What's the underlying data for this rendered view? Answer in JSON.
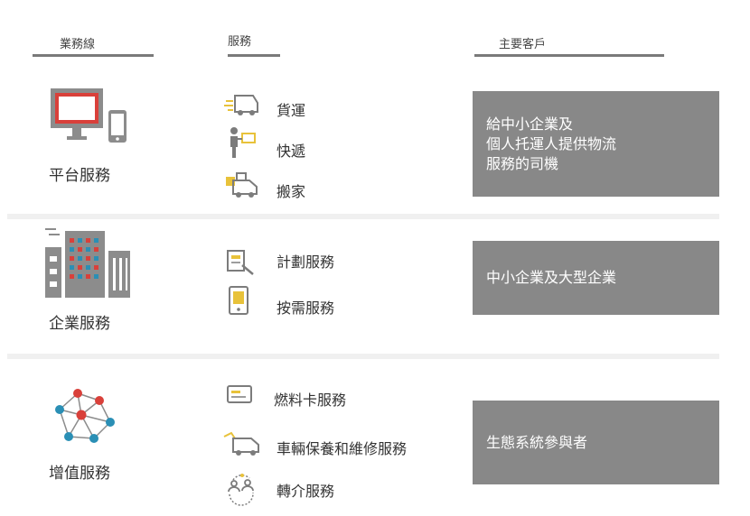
{
  "headers": {
    "business_line": "業務線",
    "service": "服務",
    "main_customer": "主要客戶"
  },
  "rows": [
    {
      "category": "平台服務",
      "category_icon": "computer-mobile-icon",
      "services": [
        {
          "label": "貨運",
          "icon": "delivery-van-icon"
        },
        {
          "label": "快遞",
          "icon": "courier-icon"
        },
        {
          "label": "搬家",
          "icon": "moving-truck-icon"
        }
      ],
      "customer_lines": [
        "給中小企業及",
        "個人托運人提供物流",
        "服務的司機"
      ]
    },
    {
      "category": "企業服務",
      "category_icon": "office-buildings-icon",
      "services": [
        {
          "label": "計劃服務",
          "icon": "plan-document-icon"
        },
        {
          "label": "按需服務",
          "icon": "on-demand-phone-icon"
        }
      ],
      "customer_lines": [
        "中小企業及大型企業"
      ]
    },
    {
      "category": "增值服務",
      "category_icon": "network-nodes-icon",
      "services": [
        {
          "label": "燃料卡服務",
          "icon": "fuel-card-icon"
        },
        {
          "label": "車輛保養和維修服務",
          "icon": "vehicle-maintenance-icon"
        },
        {
          "label": "轉介服務",
          "icon": "referral-people-icon"
        }
      ],
      "customer_lines": [
        "生態系統參與者"
      ]
    }
  ],
  "colors": {
    "accent_red": "#d9403a",
    "accent_yellow": "#e8c23a",
    "accent_blue": "#2a8fb5",
    "icon_gray": "#7c7c7c",
    "box_gray": "#888888"
  }
}
